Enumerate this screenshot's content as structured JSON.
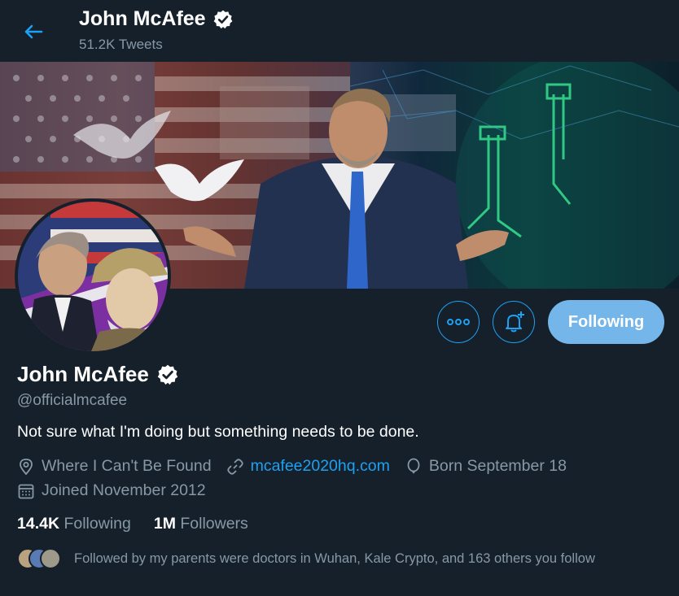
{
  "header": {
    "title": "John McAfee",
    "tweet_count": "51.2K Tweets",
    "back_icon": "arrow-left-icon",
    "verified_icon": "verified-badge-icon"
  },
  "banner": {
    "description_icon": "profile-banner-image"
  },
  "actions": {
    "more_icon": "more-dots-icon",
    "notify_icon": "bell-plus-icon",
    "follow_label": "Following"
  },
  "profile": {
    "name": "John McAfee",
    "handle": "@officialmcafee",
    "bio": "Not sure what I'm doing but something needs to be done.",
    "location": "Where I Can't Be Found",
    "website": "mcafee2020hq.com",
    "birthday": "Born September 18",
    "joined": "Joined November 2012"
  },
  "counts": {
    "following_num": "14.4K",
    "following_label": "Following",
    "followers_num": "1M",
    "followers_label": "Followers"
  },
  "followed_by": {
    "text": "Followed by my parents were doctors in Wuhan, Kale Crypto, and 163 others you follow"
  },
  "colors": {
    "background": "#15202b",
    "accent": "#1da1f2",
    "follow_button": "#74b5ea",
    "secondary_text": "#8899a6"
  }
}
